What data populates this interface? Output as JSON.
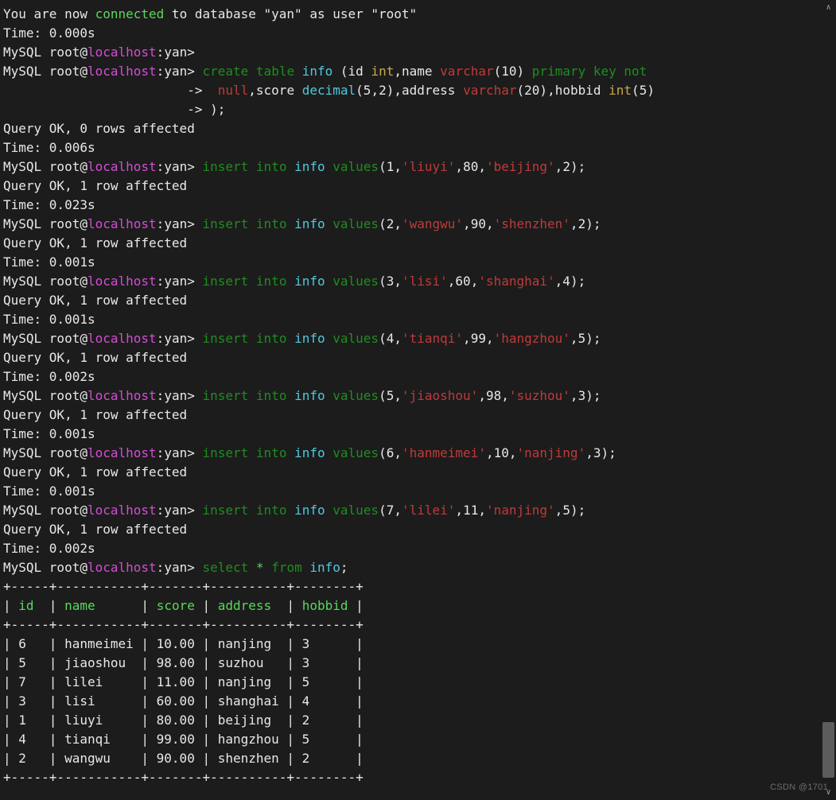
{
  "prompt": {
    "prefix": "MySQL root@",
    "host": "localhost",
    "sep": ":",
    "db": "yan",
    "suffix": "> ",
    "cont": "                        -> "
  },
  "intro_line": {
    "seg1": "You are now ",
    "connected": "connected",
    "seg2": " to database \"yan\" as user \"root\""
  },
  "responses": {
    "ok0": "Query OK, 0 rows affected",
    "ok1": "Query OK, 1 row affected",
    "t0_000": "Time: 0.000s",
    "t0_006": "Time: 0.006s",
    "t0_023": "Time: 0.023s",
    "t0_001": "Time: 0.001s",
    "t0_002": "Time: 0.002s"
  },
  "kw": {
    "create": "create",
    "table": "table",
    "insert": "insert",
    "into": "into",
    "values": "values",
    "select": "select",
    "from": "from",
    "primary_key": "primary key",
    "not": "not",
    "null": "null",
    "int": "int",
    "varchar": "varchar",
    "decimal": "decimal",
    "star": "*"
  },
  "ident": {
    "info": "info",
    "id": "id",
    "name": "name",
    "score": "score",
    "address": "address",
    "hobbid": "hobbid"
  },
  "create_nums": {
    "varchar10": "10",
    "dec5": "5",
    "dec2": "2",
    "varchar20": "20",
    "int5": "5"
  },
  "inserts": [
    {
      "id": "1",
      "name": "liuyi",
      "score": "80",
      "address": "beijing",
      "hobbid": "2"
    },
    {
      "id": "2",
      "name": "wangwu",
      "score": "90",
      "address": "shenzhen",
      "hobbid": "2"
    },
    {
      "id": "3",
      "name": "lisi",
      "score": "60",
      "address": "shanghai",
      "hobbid": "4"
    },
    {
      "id": "4",
      "name": "tianqi",
      "score": "99",
      "address": "hangzhou",
      "hobbid": "5"
    },
    {
      "id": "5",
      "name": "jiaoshou",
      "score": "98",
      "address": "suzhou",
      "hobbid": "3"
    },
    {
      "id": "6",
      "name": "hanmeimei",
      "score": "10",
      "address": "nanjing",
      "hobbid": "3"
    },
    {
      "id": "7",
      "name": "lilei",
      "score": "11",
      "address": "nanjing",
      "hobbid": "5"
    }
  ],
  "insert_times": [
    "t0_023",
    "t0_001",
    "t0_001",
    "t0_002",
    "t0_001",
    "t0_001",
    "t0_002"
  ],
  "table": {
    "border": "+-----+-----------+-------+----------+--------+",
    "header": [
      "id",
      "name",
      "score",
      "address",
      "hobbid"
    ],
    "widths": [
      5,
      11,
      7,
      10,
      8
    ],
    "rows": [
      {
        "id": "6",
        "name": "hanmeimei",
        "score": "10.00",
        "address": "nanjing",
        "hobbid": "3"
      },
      {
        "id": "5",
        "name": "jiaoshou",
        "score": "98.00",
        "address": "suzhou",
        "hobbid": "3"
      },
      {
        "id": "7",
        "name": "lilei",
        "score": "11.00",
        "address": "nanjing",
        "hobbid": "5"
      },
      {
        "id": "3",
        "name": "lisi",
        "score": "60.00",
        "address": "shanghai",
        "hobbid": "4"
      },
      {
        "id": "1",
        "name": "liuyi",
        "score": "80.00",
        "address": "beijing",
        "hobbid": "2"
      },
      {
        "id": "4",
        "name": "tianqi",
        "score": "99.00",
        "address": "hangzhou",
        "hobbid": "5"
      },
      {
        "id": "2",
        "name": "wangwu",
        "score": "90.00",
        "address": "shenzhen",
        "hobbid": "2"
      }
    ]
  },
  "watermark": "CSDN @1701",
  "punct": {
    "lparen": "(",
    "rparen": ")",
    "comma": ",",
    "semi": ";",
    "sq": "'",
    "space": " ",
    "rpsemi": ");"
  }
}
